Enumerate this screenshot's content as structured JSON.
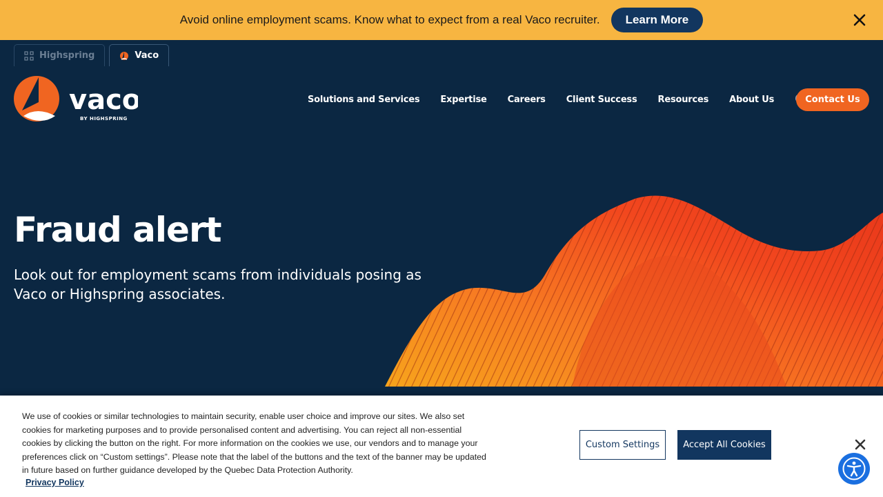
{
  "alert": {
    "text": "Avoid online employment scams. Know what to expect from a real Vaco recruiter.",
    "button": "Learn More",
    "close_icon": "close-icon"
  },
  "brand_tabs": [
    {
      "label": "Highspring",
      "icon": "highspring-icon"
    },
    {
      "label": "Vaco",
      "icon": "vaco-mark-icon"
    }
  ],
  "logo": {
    "word": "vaco",
    "tagline": "BY HIGHSPRING"
  },
  "nav": {
    "items": [
      "Solutions and Services",
      "Expertise",
      "Careers",
      "Client Success",
      "Resources",
      "About Us"
    ],
    "search_icon": "search-icon",
    "globe_icon": "globe-icon",
    "contact": "Contact Us"
  },
  "hero": {
    "title": "Fraud alert",
    "subtitle": "Look out for employment scams from individuals posing as Vaco or Highspring associates."
  },
  "cookie": {
    "text": "We use of cookies or similar technologies to maintain security, enable user choice and improve our sites. We also set cookies for marketing purposes and to provide personalised content and advertising. You can reject all non-essential cookies by clicking the button on the right. For more information on the cookies we use, our vendors and to manage your preferences click on “Custom settings”. Please note that the label of the buttons and the text of the banner may be updated in future based on further guidance developed by the Quebec Data Protection Authority.",
    "privacy_link": "Privacy Policy",
    "custom_button": "Custom Settings",
    "accept_button": "Accept All Cookies"
  },
  "colors": {
    "alert_bg": "#f7b541",
    "navy": "#0b2742",
    "button_navy": "#12365f",
    "orange": "#f06521",
    "a11y_blue": "#1a6fe0"
  }
}
